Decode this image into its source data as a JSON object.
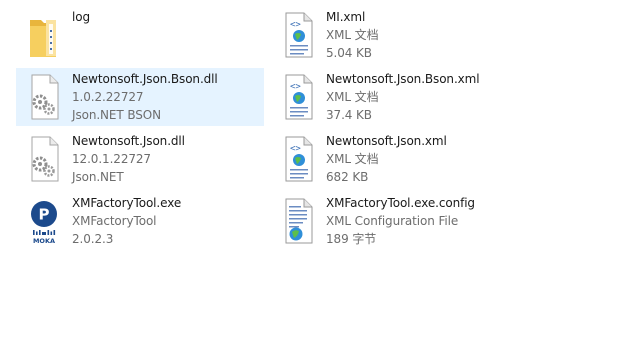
{
  "files": [
    {
      "name": "log",
      "line2": "",
      "line3": "",
      "icon": "folder-icon"
    },
    {
      "name": "MI.xml",
      "line2": "XML 文档",
      "line3": "5.04 KB",
      "icon": "xml-document-icon"
    },
    {
      "name": "Newtonsoft.Json.Bson.dll",
      "line2": "1.0.2.22727",
      "line3": "Json.NET BSON",
      "icon": "dll-gear-icon",
      "selected": true
    },
    {
      "name": "Newtonsoft.Json.Bson.xml",
      "line2": "XML 文档",
      "line3": "37.4 KB",
      "icon": "xml-document-icon"
    },
    {
      "name": "Newtonsoft.Json.dll",
      "line2": "12.0.1.22727",
      "line3": "Json.NET",
      "icon": "dll-gear-icon"
    },
    {
      "name": "Newtonsoft.Json.xml",
      "line2": "XML 文档",
      "line3": "682 KB",
      "icon": "xml-document-icon"
    },
    {
      "name": "XMFactoryTool.exe",
      "line2": "XMFactoryTool",
      "line3": "2.0.2.3",
      "icon": "moka-app-icon",
      "logo_text": "MOKA",
      "logo_letter": "P"
    },
    {
      "name": "XMFactoryTool.exe.config",
      "line2": "XML Configuration File",
      "line3": "189 字节",
      "icon": "config-document-icon"
    }
  ],
  "colors": {
    "selection": "#e5f3ff",
    "folder": "#f3c44d",
    "moka_blue": "#1c4a8c"
  }
}
